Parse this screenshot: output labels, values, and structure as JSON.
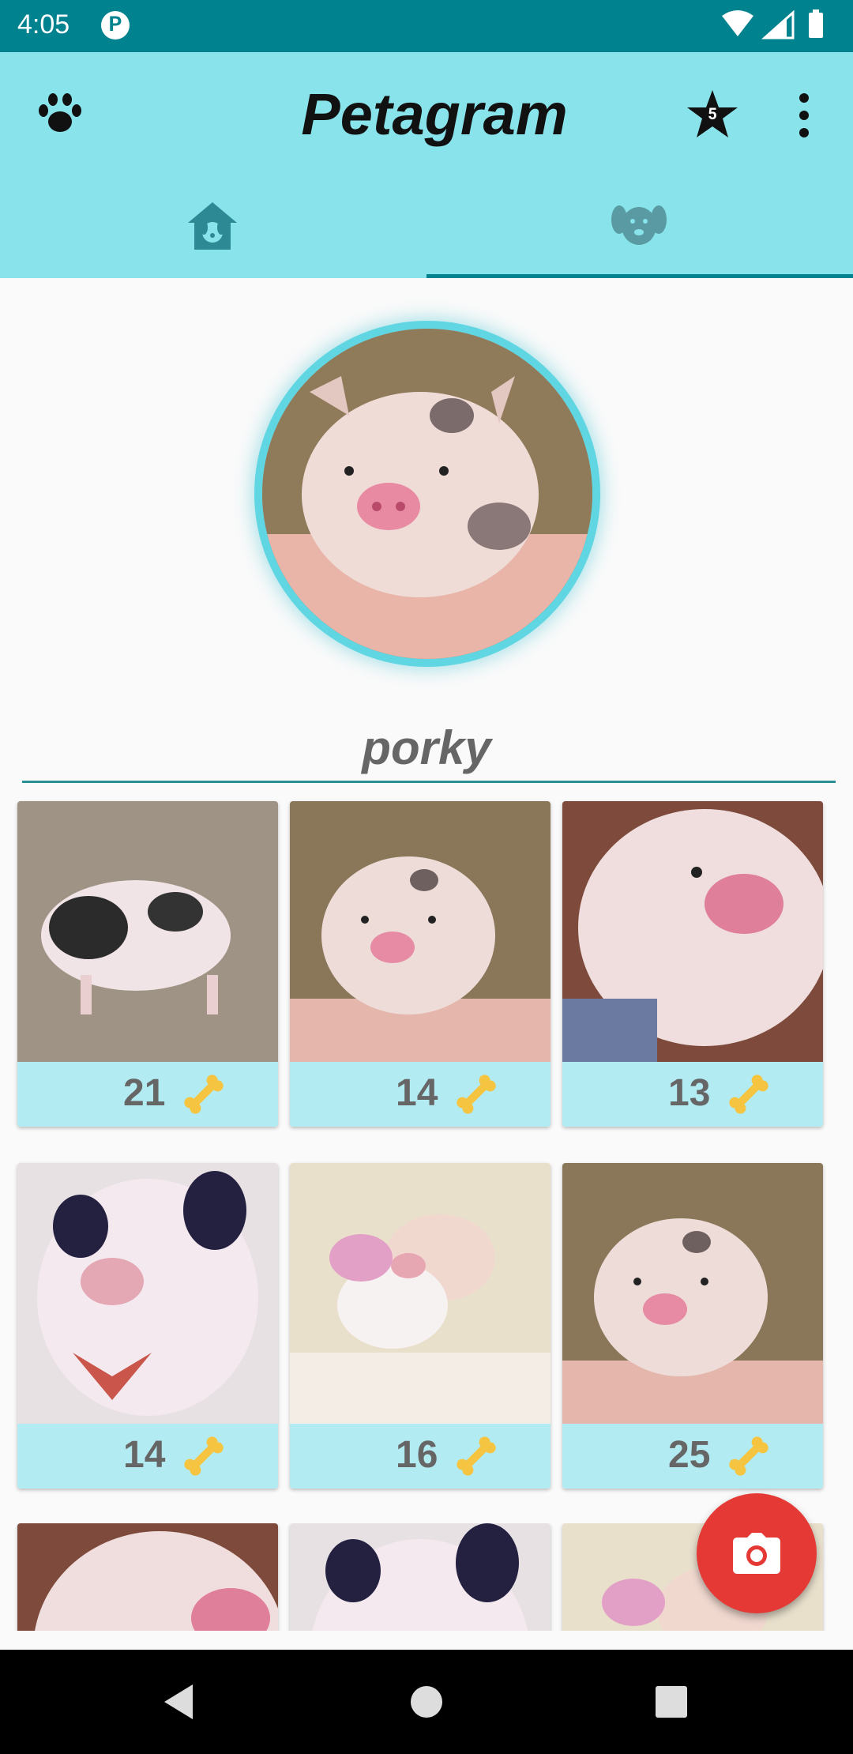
{
  "status_bar": {
    "time": "4:05",
    "notif_badge": "P"
  },
  "app_bar": {
    "title": "Petagram",
    "favorites_badge": "5"
  },
  "tabs": [
    {
      "name": "home",
      "icon": "dog-house-icon",
      "selected": false
    },
    {
      "name": "profile",
      "icon": "dog-face-icon",
      "selected": true
    }
  ],
  "profile": {
    "username": "porky"
  },
  "grid": [
    {
      "likes": "21"
    },
    {
      "likes": "14"
    },
    {
      "likes": "13"
    },
    {
      "likes": "14"
    },
    {
      "likes": "16"
    },
    {
      "likes": "25"
    }
  ],
  "colors": {
    "accent": "#00838f",
    "app_bar": "#89e3eb",
    "card_footer": "#b3ebf2",
    "fab": "#e53935"
  }
}
